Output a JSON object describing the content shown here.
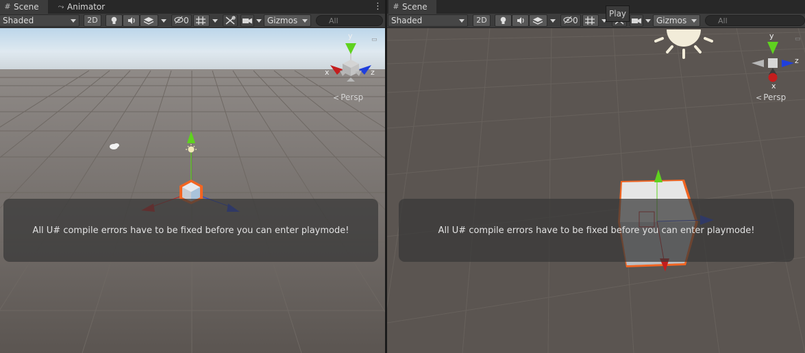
{
  "panels": {
    "left": {
      "tabs": [
        {
          "label": "Scene",
          "icon": "grid-icon",
          "active": true
        },
        {
          "label": "Animator",
          "icon": "animator-icon",
          "active": false
        }
      ],
      "toolbar": {
        "shading_mode": "Shaded",
        "mode_2d": "2D",
        "hidden_count": "0",
        "gizmos": "Gizmos",
        "search_placeholder": "All"
      },
      "view_label": "Persp",
      "axis_labels": {
        "x": "x",
        "y": "y",
        "z": "z"
      },
      "overlay_message": "All U# compile errors have to be fixed before you can enter playmode!"
    },
    "right": {
      "tabs": [
        {
          "label": "Scene",
          "icon": "grid-icon",
          "active": true
        }
      ],
      "toolbar": {
        "shading_mode": "Shaded",
        "mode_2d": "2D",
        "hidden_count": "0",
        "gizmos": "Gizmos",
        "search_placeholder": "All"
      },
      "view_label": "Persp",
      "axis_labels": {
        "x": "x",
        "y": "y",
        "z": "z"
      },
      "overlay_message": "All U# compile errors have to be fixed before you can enter playmode!"
    }
  },
  "tooltip": {
    "text": "Play"
  },
  "colors": {
    "sky": "#dbe9f3",
    "ground": "#5b5551",
    "grid": "#6c6661",
    "selection": "#f26522",
    "axis_x": "#c41d1d",
    "axis_y": "#5fd21f",
    "axis_z": "#1f3fdc",
    "panel_bg": "#3c3c3c"
  }
}
